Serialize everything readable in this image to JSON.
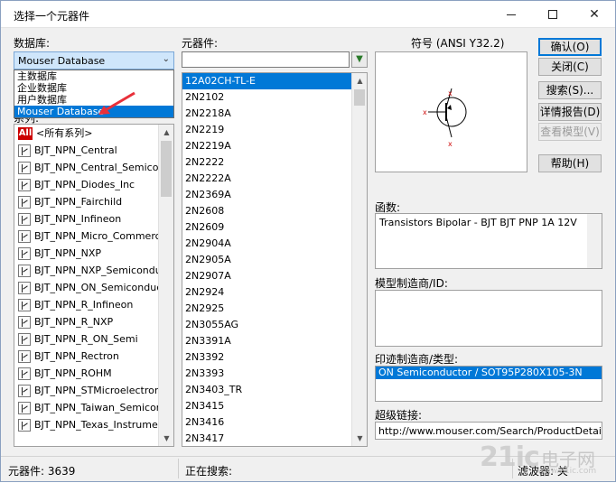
{
  "window": {
    "title": "选择一个元器件",
    "minimize_icon": "minimize-icon",
    "maximize_icon": "maximize-icon",
    "close_icon": "close-icon",
    "close_glyph": "✕"
  },
  "database": {
    "label": "数据库:",
    "selected": "Mouser Database",
    "options": [
      "主数据库",
      "企业数据库",
      "用户数据库",
      "Mouser Database"
    ],
    "highlighted_option": "Mouser Database"
  },
  "series": {
    "label": "系列:",
    "all_label": "All",
    "items": [
      "<所有系列>",
      "BJT_NPN_Central",
      "BJT_NPN_Central_Semicon",
      "BJT_NPN_Diodes_Inc",
      "BJT_NPN_Fairchild",
      "BJT_NPN_Infineon",
      "BJT_NPN_Micro_Commercia",
      "BJT_NPN_NXP",
      "BJT_NPN_NXP_Semiconduct",
      "BJT_NPN_ON_Semiconducto",
      "BJT_NPN_R_Infineon",
      "BJT_NPN_R_NXP",
      "BJT_NPN_R_ON_Semi",
      "BJT_NPN_Rectron",
      "BJT_NPN_ROHM",
      "BJT_NPN_STMicroelectronic",
      "BJT_NPN_Taiwan_Semicono",
      "BJT_NPN_Texas_Instrumen"
    ]
  },
  "components": {
    "label": "元器件:",
    "search_value": "",
    "filter_icon": "filter-icon",
    "selected": "12A02CH-TL-E",
    "items": [
      "12A02CH-TL-E",
      "2N2102",
      "2N2218A",
      "2N2219",
      "2N2219A",
      "2N2222",
      "2N2222A",
      "2N2369A",
      "2N2608",
      "2N2609",
      "2N2904A",
      "2N2905A",
      "2N2907A",
      "2N2924",
      "2N2925",
      "2N3055AG",
      "2N3391A",
      "2N3392",
      "2N3393",
      "2N3403_TR",
      "2N3415",
      "2N3416",
      "2N3417"
    ]
  },
  "symbol": {
    "label": "符号 (ANSI Y32.2)",
    "icon": "pnp-transistor-symbol"
  },
  "buttons": {
    "ok": "确认(O)",
    "close": "关闭(C)",
    "search": "搜索(S)...",
    "detail": "详情报告(D)",
    "view_model": "查看模型(V)",
    "help": "帮助(H)"
  },
  "function": {
    "label": "函数:",
    "value": "Transistors Bipolar - BJT BJT PNP 1A 12V"
  },
  "model_manufacturer": {
    "label": "模型制造商/ID:",
    "value": ""
  },
  "footprint": {
    "label": "印迹制造商/类型:",
    "selected": "ON Semiconductor / SOT95P280X105-3N"
  },
  "hyperlink": {
    "label": "超级链接:",
    "value": "http://www.mouser.com/Search/ProductDetail.asp"
  },
  "status": {
    "count_label": "元器件:",
    "count": "3639",
    "searching_label": "正在搜索:",
    "filter_label": "滤波器:",
    "filter_value": "关"
  },
  "watermark": {
    "logo": "21ic",
    "cn": "电子网",
    "url": "www.21ic.com"
  },
  "colors": {
    "selection": "#0078d7",
    "combo_bg": "#cfe6fb",
    "annotation_arrow": "#e8303a",
    "symbol_pins": "#d01010"
  }
}
